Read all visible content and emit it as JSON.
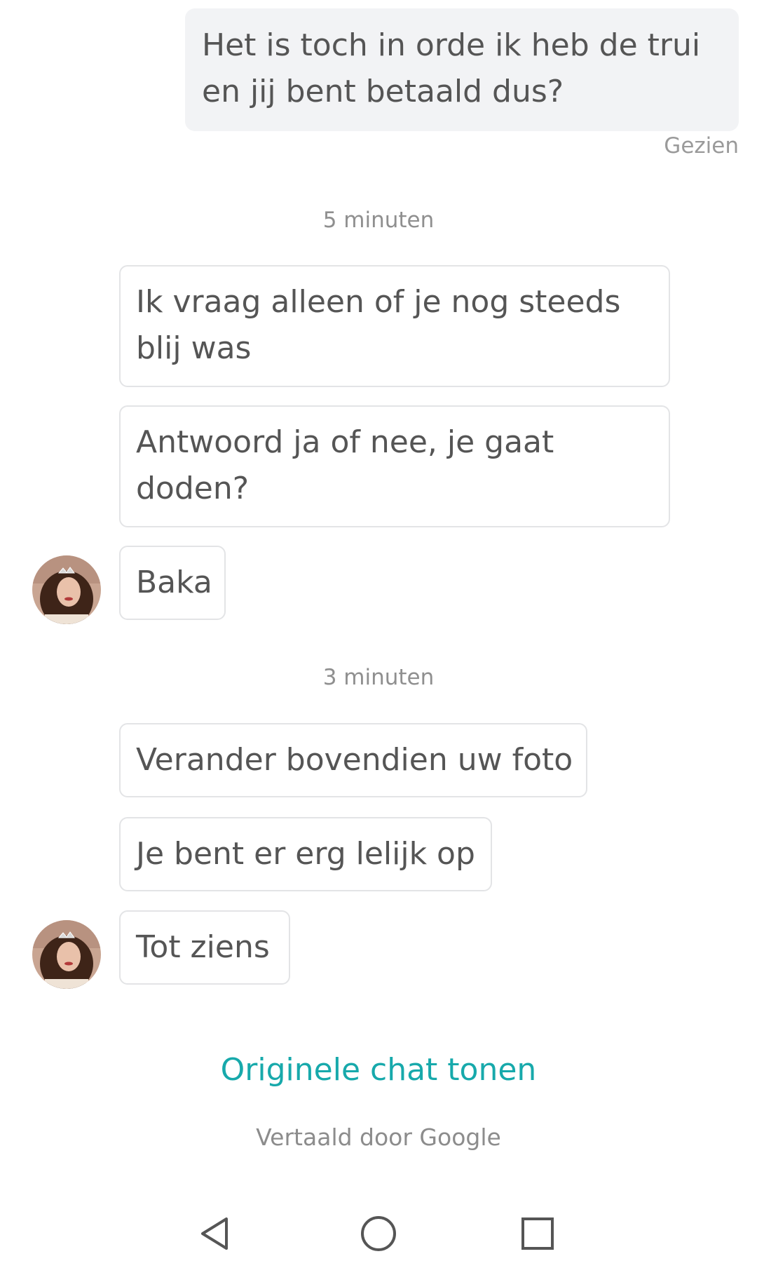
{
  "messages": [
    {
      "direction": "out",
      "text_lines": [
        "Het is toch in orde ik heb de trui",
        "en jij bent betaald dus?"
      ]
    },
    {
      "direction": "in",
      "text_lines": [
        "Ik vraag alleen of je nog steeds",
        "blij was"
      ]
    },
    {
      "direction": "in",
      "text_lines": [
        "Antwoord ja of nee, je gaat",
        "doden?"
      ]
    },
    {
      "direction": "in",
      "text_lines": [
        "Baka"
      ]
    },
    {
      "direction": "in",
      "text_lines": [
        "Verander bovendien uw foto"
      ]
    },
    {
      "direction": "in",
      "text_lines": [
        "Je bent er erg lelijk op"
      ]
    },
    {
      "direction": "in",
      "text_lines": [
        "Tot ziens"
      ]
    }
  ],
  "seen_status": "Gezien",
  "time_separators": [
    "5 minuten",
    "3 minuten"
  ],
  "show_original_label": "Originele chat tonen",
  "translated_by": "Vertaald door Google",
  "nav_icons": [
    "back-icon",
    "home-icon",
    "recents-icon"
  ],
  "colors": {
    "accent": "#17a9ab",
    "outgoing_bubble": "#f2f3f5",
    "incoming_border": "#e3e4e6"
  }
}
